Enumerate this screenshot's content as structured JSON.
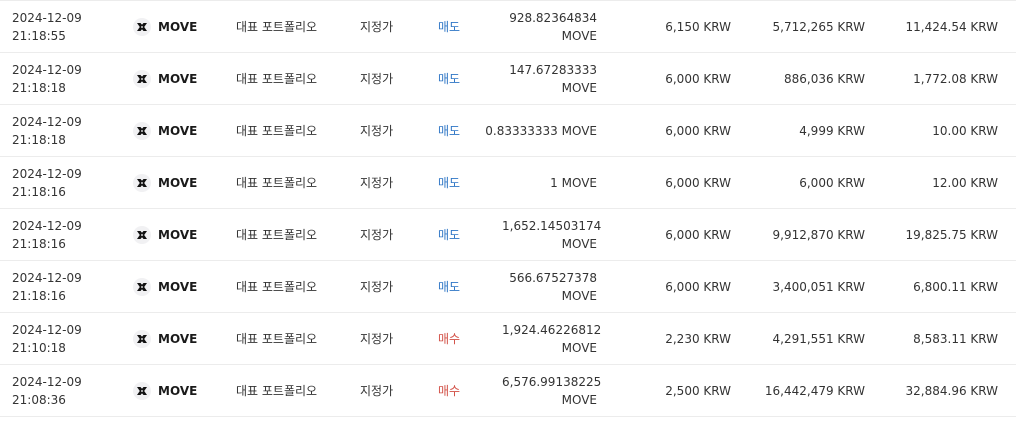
{
  "colors": {
    "sell": "#2f76c5",
    "buy": "#d24f45",
    "divider": "#ececec"
  },
  "icons": {
    "coin": "move-coin-icon"
  },
  "rows": [
    {
      "date": "2024-12-09",
      "time": "21:18:55",
      "coin": "MOVE",
      "portfolio": "대표 포트폴리오",
      "order_type": "지정가",
      "side": "매도",
      "side_kind": "sell",
      "qty": "928.82364834 MOVE",
      "price": "6,150 KRW",
      "amount": "5,712,265 KRW",
      "fee": "11,424.54 KRW"
    },
    {
      "date": "2024-12-09",
      "time": "21:18:18",
      "coin": "MOVE",
      "portfolio": "대표 포트폴리오",
      "order_type": "지정가",
      "side": "매도",
      "side_kind": "sell",
      "qty": "147.67283333 MOVE",
      "price": "6,000 KRW",
      "amount": "886,036 KRW",
      "fee": "1,772.08 KRW"
    },
    {
      "date": "2024-12-09",
      "time": "21:18:18",
      "coin": "MOVE",
      "portfolio": "대표 포트폴리오",
      "order_type": "지정가",
      "side": "매도",
      "side_kind": "sell",
      "qty": "0.83333333 MOVE",
      "price": "6,000 KRW",
      "amount": "4,999 KRW",
      "fee": "10.00 KRW"
    },
    {
      "date": "2024-12-09",
      "time": "21:18:16",
      "coin": "MOVE",
      "portfolio": "대표 포트폴리오",
      "order_type": "지정가",
      "side": "매도",
      "side_kind": "sell",
      "qty": "1 MOVE",
      "price": "6,000 KRW",
      "amount": "6,000 KRW",
      "fee": "12.00 KRW"
    },
    {
      "date": "2024-12-09",
      "time": "21:18:16",
      "coin": "MOVE",
      "portfolio": "대표 포트폴리오",
      "order_type": "지정가",
      "side": "매도",
      "side_kind": "sell",
      "qty": "1,652.14503174 MOVE",
      "price": "6,000 KRW",
      "amount": "9,912,870 KRW",
      "fee": "19,825.75 KRW"
    },
    {
      "date": "2024-12-09",
      "time": "21:18:16",
      "coin": "MOVE",
      "portfolio": "대표 포트폴리오",
      "order_type": "지정가",
      "side": "매도",
      "side_kind": "sell",
      "qty": "566.67527378 MOVE",
      "price": "6,000 KRW",
      "amount": "3,400,051 KRW",
      "fee": "6,800.11 KRW"
    },
    {
      "date": "2024-12-09",
      "time": "21:10:18",
      "coin": "MOVE",
      "portfolio": "대표 포트폴리오",
      "order_type": "지정가",
      "side": "매수",
      "side_kind": "buy",
      "qty": "1,924.46226812 MOVE",
      "price": "2,230 KRW",
      "amount": "4,291,551 KRW",
      "fee": "8,583.11 KRW"
    },
    {
      "date": "2024-12-09",
      "time": "21:08:36",
      "coin": "MOVE",
      "portfolio": "대표 포트폴리오",
      "order_type": "지정가",
      "side": "매수",
      "side_kind": "buy",
      "qty": "6,576.99138225 MOVE",
      "price": "2,500 KRW",
      "amount": "16,442,479 KRW",
      "fee": "32,884.96 KRW"
    }
  ]
}
